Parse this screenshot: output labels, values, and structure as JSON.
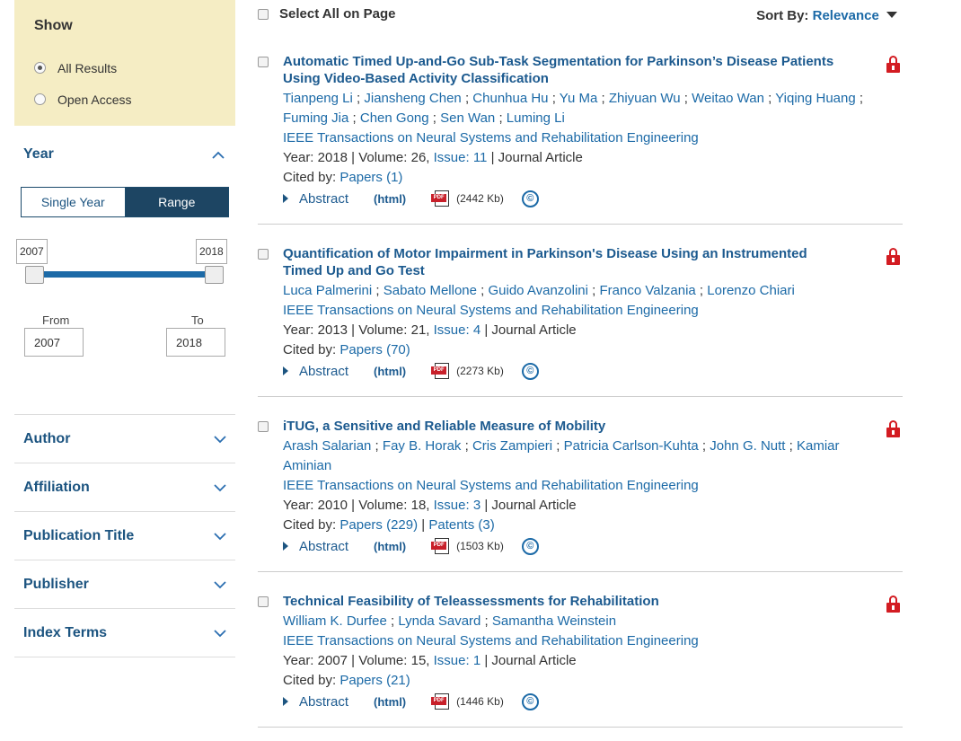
{
  "sidebar": {
    "show": {
      "title": "Show",
      "options": [
        {
          "label": "All Results",
          "checked": true
        },
        {
          "label": "Open Access",
          "checked": false
        }
      ]
    },
    "year": {
      "title": "Year",
      "toggle": {
        "single": "Single Year",
        "range": "Range",
        "active": "Range"
      },
      "slider": {
        "min_label": "2007",
        "max_label": "2018",
        "low": 2007,
        "high": 2018
      },
      "from_label": "From",
      "to_label": "To",
      "from_value": "2007",
      "to_value": "2018"
    },
    "facets": [
      "Author",
      "Affiliation",
      "Publication Title",
      "Publisher",
      "Index Terms"
    ]
  },
  "toolbar": {
    "select_all": "Select All on Page",
    "sort_label": "Sort By:",
    "sort_value": "Relevance"
  },
  "results": [
    {
      "title": "Automatic Timed Up-and-Go Sub-Task Segmentation for Parkinson’s Disease Patients Using Video-Based Activity Classification",
      "authors": [
        "Tianpeng Li",
        "Jiansheng Chen",
        "Chunhua Hu",
        "Yu Ma",
        "Zhiyuan Wu",
        "Weitao Wan",
        "Yiqing Huang",
        "Fuming Jia",
        "Chen Gong",
        "Sen Wan",
        "Luming Li"
      ],
      "journal": "IEEE Transactions on Neural Systems and Rehabilitation Engineering",
      "year_text": "Year: 2018 | Volume: 26,",
      "issue_link": "Issue: 11",
      "type_text": "| Journal Article",
      "cited_label": "Cited by:",
      "cited_papers": "Papers (1)",
      "cited_patents": "",
      "abstract": "Abstract",
      "html": "(html)",
      "pdf_size": "(2442 Kb)"
    },
    {
      "title": "Quantification of Motor Impairment in Parkinson's Disease Using an Instrumented Timed Up and Go Test",
      "authors": [
        "Luca Palmerini",
        "Sabato Mellone",
        "Guido Avanzolini",
        "Franco Valzania",
        "Lorenzo Chiari"
      ],
      "journal": "IEEE Transactions on Neural Systems and Rehabilitation Engineering",
      "year_text": "Year: 2013 | Volume: 21,",
      "issue_link": "Issue: 4",
      "type_text": "| Journal Article",
      "cited_label": "Cited by:",
      "cited_papers": "Papers (70)",
      "cited_patents": "",
      "abstract": "Abstract",
      "html": "(html)",
      "pdf_size": "(2273 Kb)"
    },
    {
      "title": "iTUG, a Sensitive and Reliable Measure of Mobility",
      "authors": [
        "Arash Salarian",
        "Fay B. Horak",
        "Cris Zampieri",
        "Patricia Carlson-Kuhta",
        "John G. Nutt",
        "Kamiar Aminian"
      ],
      "journal": "IEEE Transactions on Neural Systems and Rehabilitation Engineering",
      "year_text": "Year: 2010 | Volume: 18,",
      "issue_link": "Issue: 3",
      "type_text": "| Journal Article",
      "cited_label": "Cited by:",
      "cited_papers": "Papers (229)",
      "cited_patents": "Patents (3)",
      "abstract": "Abstract",
      "html": "(html)",
      "pdf_size": "(1503 Kb)"
    },
    {
      "title": "Technical Feasibility of Teleassessments for Rehabilitation",
      "authors": [
        "William K. Durfee",
        "Lynda Savard",
        "Samantha Weinstein"
      ],
      "journal": "IEEE Transactions on Neural Systems and Rehabilitation Engineering",
      "year_text": "Year: 2007 | Volume: 15,",
      "issue_link": "Issue: 1",
      "type_text": "| Journal Article",
      "cited_label": "Cited by:",
      "cited_papers": "Papers (21)",
      "cited_patents": "",
      "abstract": "Abstract",
      "html": "(html)",
      "pdf_size": "(1446 Kb)"
    }
  ],
  "icons": {
    "lock": "lock-icon",
    "pdf": "pdf-icon",
    "copyright": "copyright-icon",
    "chevron": "chevron-icon"
  },
  "colors": {
    "link": "#1c6aa7",
    "title": "#1c5a8f",
    "show_bg": "#f5edc4",
    "range_active": "#1d4563",
    "lock": "#d31c22"
  }
}
